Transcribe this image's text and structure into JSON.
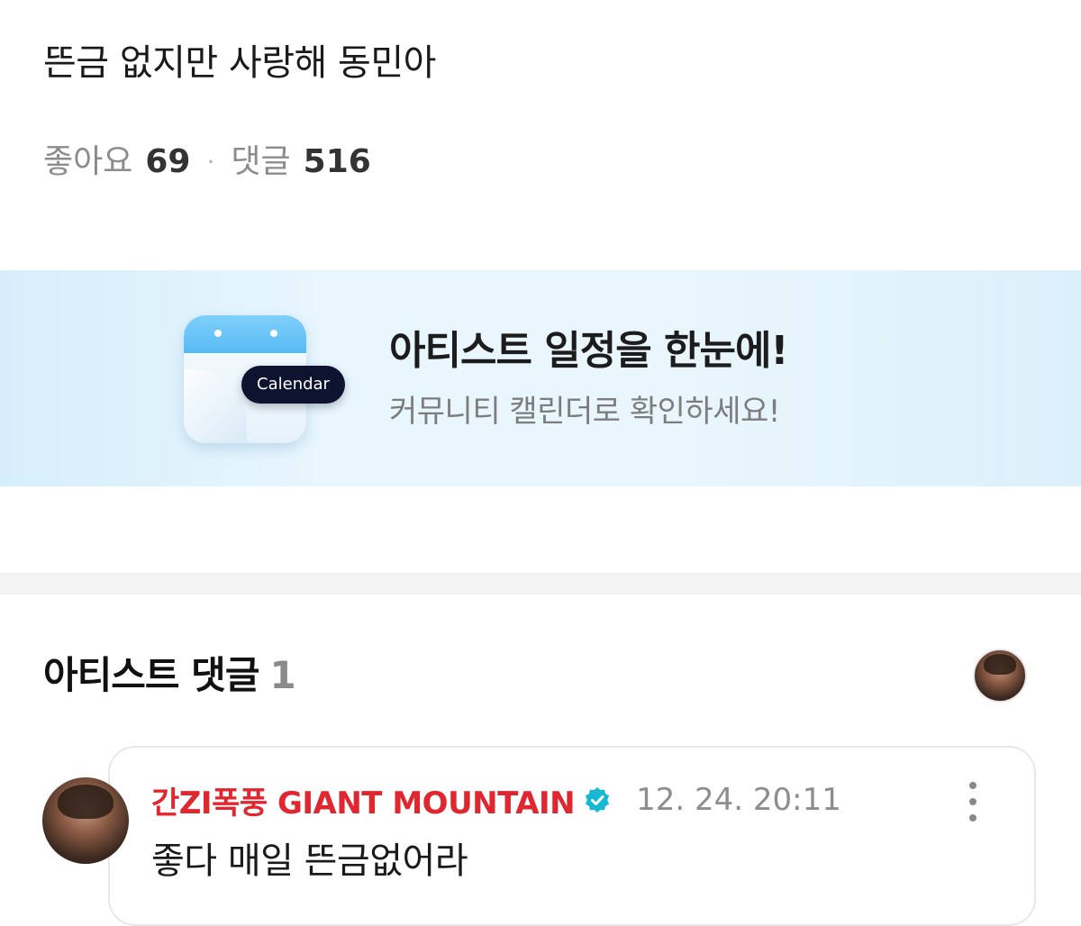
{
  "post": {
    "text": "뜬금 없지만 사랑해 동민아",
    "likes_label": "좋아요",
    "likes_count": "69",
    "separator": "·",
    "comments_label": "댓글",
    "comments_count": "516"
  },
  "banner": {
    "badge": "Calendar",
    "title": "아티스트 일정을 한눈에!",
    "subtitle": "커뮤니티 캘린더로 확인하세요!"
  },
  "artist_comments": {
    "title": "아티스트 댓글",
    "count": "1"
  },
  "comment": {
    "author": "간ZI폭풍 GIANT MOUNTAIN",
    "timestamp": "12. 24. 20:11",
    "body": "좋다 매일 뜬금없어라",
    "verified_icon": "verified-badge-icon",
    "verified_color": "#17b9d2",
    "author_color": "#e0262f"
  }
}
